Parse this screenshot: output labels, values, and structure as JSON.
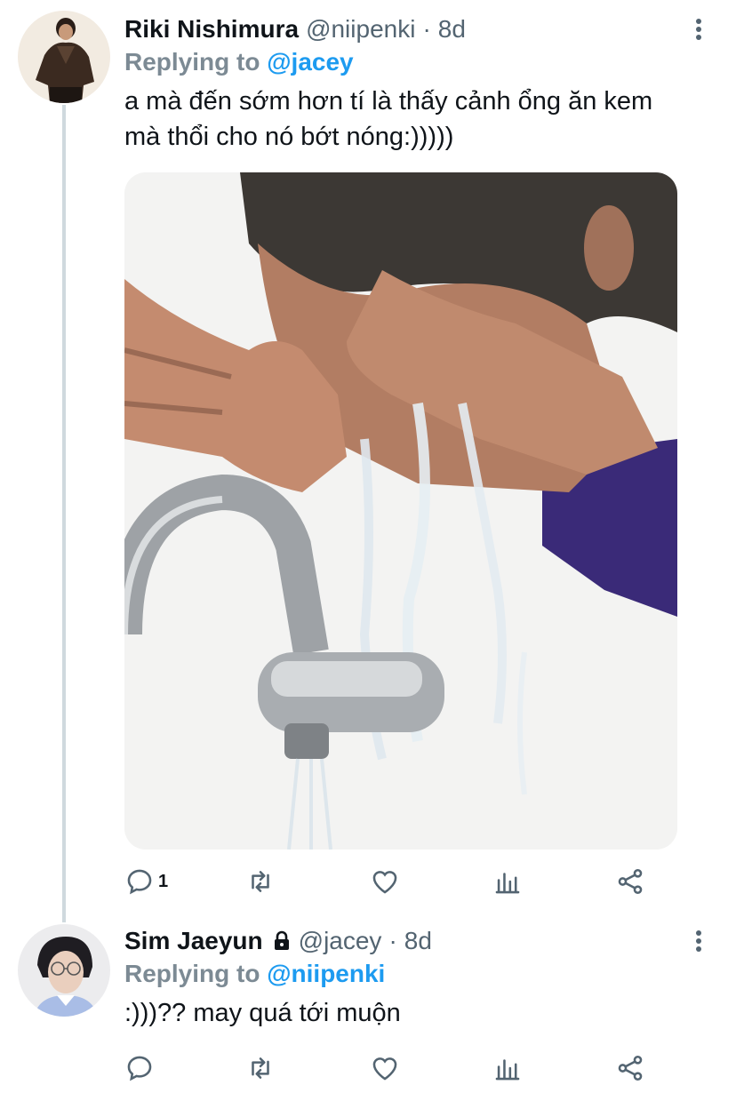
{
  "tweets": [
    {
      "display_name": "Riki Nishimura",
      "handle": "@niipenki",
      "separator": "·",
      "time": "8d",
      "replying_prefix": "Replying to",
      "replying_to": "@jacey",
      "text_line1": "a mà đến sớm hơn tí là thấy cảnh ổng ăn kem",
      "text_line2": "mà thổi cho nó bớt nóng:)))))",
      "reply_count": "1",
      "has_media": true
    },
    {
      "display_name": "Sim Jaeyun",
      "handle": "@jacey",
      "separator": "·",
      "time": "8d",
      "replying_prefix": "Replying to",
      "replying_to": "@niipenki",
      "text_line1": ":)))?? may quá tới muộn",
      "reply_count": "",
      "protected": true
    }
  ],
  "icons": [
    "more-icon",
    "reply-icon",
    "retweet-icon",
    "like-icon",
    "analytics-icon",
    "share-icon",
    "lock-icon"
  ],
  "colors": {
    "link": "#1d9bf0",
    "muted": "#536471",
    "thread_line": "#cfd9de"
  }
}
